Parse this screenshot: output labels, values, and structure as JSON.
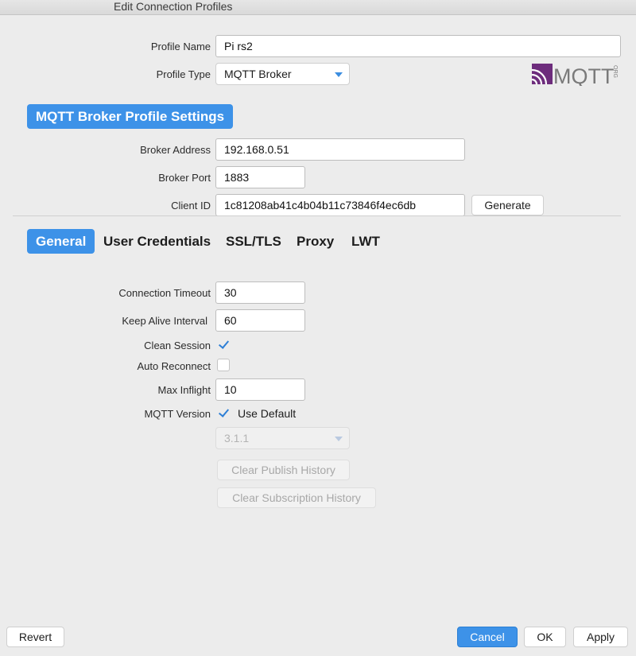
{
  "window": {
    "title": "Edit Connection Profiles"
  },
  "profile": {
    "name_label": "Profile Name",
    "name_value": "Pi rs2",
    "type_label": "Profile Type",
    "type_value": "MQTT Broker"
  },
  "logo": {
    "text": "MQTT",
    "sub": "ORG"
  },
  "section": {
    "title": "MQTT Broker Profile Settings"
  },
  "broker": {
    "address_label": "Broker Address",
    "address_value": "192.168.0.51",
    "port_label": "Broker Port",
    "port_value": "1883",
    "client_label": "Client ID",
    "client_value": "1c81208ab41c4b04b11c73846f4ec6db",
    "generate_label": "Generate"
  },
  "tabs": [
    {
      "label": "General",
      "active": true
    },
    {
      "label": "User Credentials"
    },
    {
      "label": "SSL/TLS"
    },
    {
      "label": "Proxy"
    },
    {
      "label": "LWT"
    }
  ],
  "general": {
    "timeout_label": "Connection Timeout",
    "timeout_value": "30",
    "keepalive_label": "Keep Alive Interval",
    "keepalive_value": "60",
    "clean_label": "Clean Session",
    "clean_checked": true,
    "reconnect_label": "Auto Reconnect",
    "reconnect_checked": false,
    "inflight_label": "Max Inflight",
    "inflight_value": "10",
    "version_label": "MQTT Version",
    "use_default_label": "Use Default",
    "use_default_checked": true,
    "version_value": "3.1.1",
    "clear_publish_label": "Clear Publish History",
    "clear_subscription_label": "Clear Subscription History"
  },
  "footer": {
    "revert_label": "Revert",
    "cancel_label": "Cancel",
    "ok_label": "OK",
    "apply_label": "Apply"
  },
  "colors": {
    "accent": "#3d92e8",
    "logo_purple": "#6d2c7c",
    "checkmark": "#2d7fd6"
  }
}
